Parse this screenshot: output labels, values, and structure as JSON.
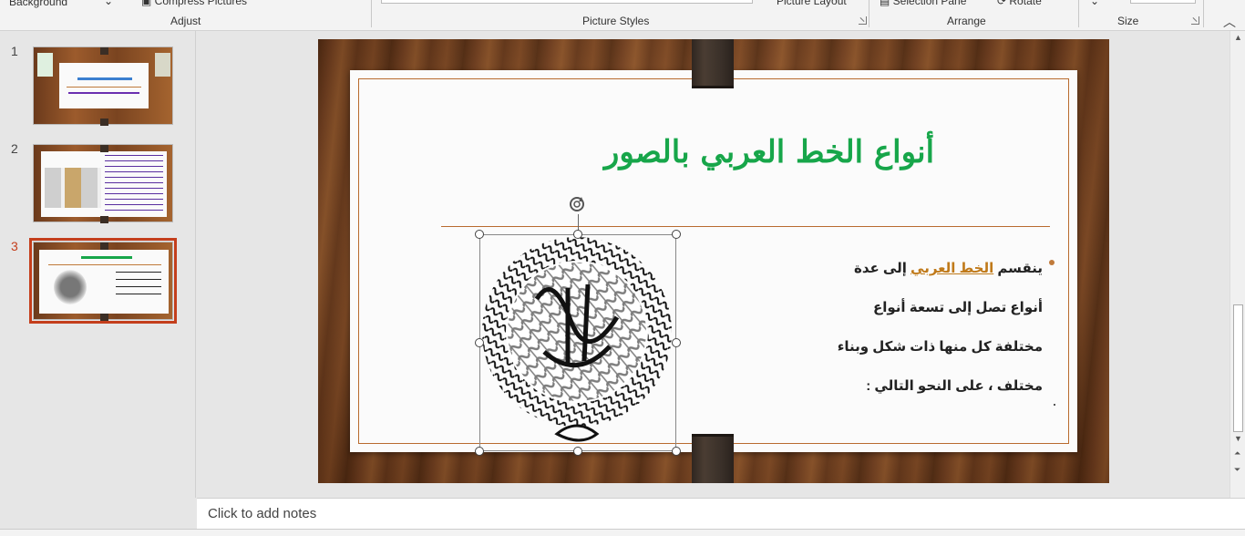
{
  "ribbon": {
    "background_label": "Background",
    "compress_label": "Compress Pictures",
    "adjust_group": "Adjust",
    "picture_styles_group": "Picture Styles",
    "picture_layout_label": "Picture Layout",
    "selection_pane_label": "Selection Pane",
    "rotate_label": "Rotate",
    "arrange_group": "Arrange",
    "size_group": "Size"
  },
  "thumbnails": [
    {
      "number": "1",
      "selected": false
    },
    {
      "number": "2",
      "selected": false
    },
    {
      "number": "3",
      "selected": true
    }
  ],
  "slide": {
    "title": "أنواع الخط العربي بالصور",
    "body_prefix": "ينقسم ",
    "body_link": "الخط العربي",
    "body_suffix": " إلى عدة",
    "line2": "أنواع تصل إلى تسعة أنواع",
    "line3": "مختلفة كل منها ذات شكل وبناء",
    "line4": "مختلف ، على النحو التالي :",
    "colors": {
      "title": "#17a64a",
      "link": "#c07a1a",
      "frame": "#b86b2e"
    }
  },
  "notes": {
    "placeholder": "Click to add notes"
  }
}
